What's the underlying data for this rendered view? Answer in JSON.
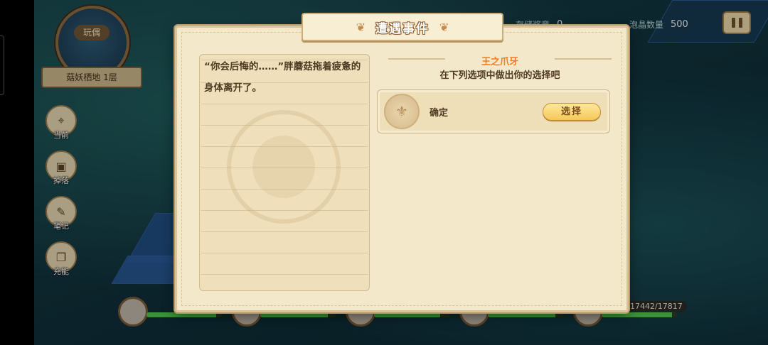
{
  "hud": {
    "stat1_label": "存储奖章",
    "stat1_value": "0",
    "stat2_label": "泡晶数量",
    "stat2_value": "500"
  },
  "minimap": {
    "button_label": "玩偶",
    "area_name": "菇妖栖地 1层"
  },
  "sidebar": {
    "items": [
      {
        "label": "当前",
        "icon": "map-pin-icon"
      },
      {
        "label": "掉落",
        "icon": "bag-icon"
      },
      {
        "label": "笔记",
        "icon": "scroll-icon"
      },
      {
        "label": "充能",
        "icon": "book-icon"
      }
    ]
  },
  "party": {
    "hp_fractions": [
      0.92,
      0.9,
      0.88,
      0.9,
      0.93
    ],
    "hp_text": "17442/17817"
  },
  "dialog": {
    "title": "遭遇事件",
    "story_text": "“你会后悔的……”胖蘑菇拖着疲惫的身体离开了。",
    "event_name": "王之爪牙",
    "event_prompt": "在下列选项中做出你的选择吧",
    "options": [
      {
        "label": "确定",
        "button": "选择"
      }
    ]
  }
}
